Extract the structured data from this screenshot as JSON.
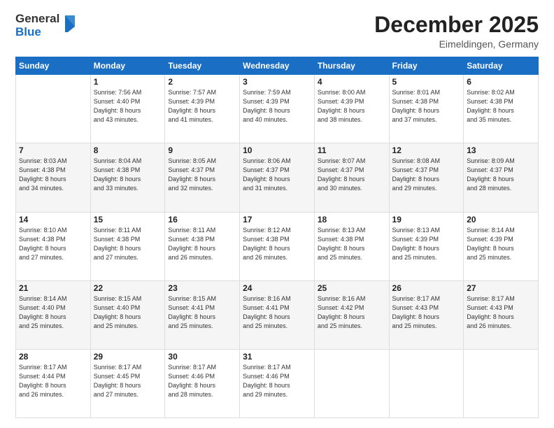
{
  "header": {
    "logo_line1": "General",
    "logo_line2": "Blue",
    "month": "December 2025",
    "location": "Eimeldingen, Germany"
  },
  "weekdays": [
    "Sunday",
    "Monday",
    "Tuesday",
    "Wednesday",
    "Thursday",
    "Friday",
    "Saturday"
  ],
  "rows": [
    [
      {
        "day": "",
        "info": ""
      },
      {
        "day": "1",
        "info": "Sunrise: 7:56 AM\nSunset: 4:40 PM\nDaylight: 8 hours\nand 43 minutes."
      },
      {
        "day": "2",
        "info": "Sunrise: 7:57 AM\nSunset: 4:39 PM\nDaylight: 8 hours\nand 41 minutes."
      },
      {
        "day": "3",
        "info": "Sunrise: 7:59 AM\nSunset: 4:39 PM\nDaylight: 8 hours\nand 40 minutes."
      },
      {
        "day": "4",
        "info": "Sunrise: 8:00 AM\nSunset: 4:39 PM\nDaylight: 8 hours\nand 38 minutes."
      },
      {
        "day": "5",
        "info": "Sunrise: 8:01 AM\nSunset: 4:38 PM\nDaylight: 8 hours\nand 37 minutes."
      },
      {
        "day": "6",
        "info": "Sunrise: 8:02 AM\nSunset: 4:38 PM\nDaylight: 8 hours\nand 35 minutes."
      }
    ],
    [
      {
        "day": "7",
        "info": "Sunrise: 8:03 AM\nSunset: 4:38 PM\nDaylight: 8 hours\nand 34 minutes."
      },
      {
        "day": "8",
        "info": "Sunrise: 8:04 AM\nSunset: 4:38 PM\nDaylight: 8 hours\nand 33 minutes."
      },
      {
        "day": "9",
        "info": "Sunrise: 8:05 AM\nSunset: 4:37 PM\nDaylight: 8 hours\nand 32 minutes."
      },
      {
        "day": "10",
        "info": "Sunrise: 8:06 AM\nSunset: 4:37 PM\nDaylight: 8 hours\nand 31 minutes."
      },
      {
        "day": "11",
        "info": "Sunrise: 8:07 AM\nSunset: 4:37 PM\nDaylight: 8 hours\nand 30 minutes."
      },
      {
        "day": "12",
        "info": "Sunrise: 8:08 AM\nSunset: 4:37 PM\nDaylight: 8 hours\nand 29 minutes."
      },
      {
        "day": "13",
        "info": "Sunrise: 8:09 AM\nSunset: 4:37 PM\nDaylight: 8 hours\nand 28 minutes."
      }
    ],
    [
      {
        "day": "14",
        "info": "Sunrise: 8:10 AM\nSunset: 4:38 PM\nDaylight: 8 hours\nand 27 minutes."
      },
      {
        "day": "15",
        "info": "Sunrise: 8:11 AM\nSunset: 4:38 PM\nDaylight: 8 hours\nand 27 minutes."
      },
      {
        "day": "16",
        "info": "Sunrise: 8:11 AM\nSunset: 4:38 PM\nDaylight: 8 hours\nand 26 minutes."
      },
      {
        "day": "17",
        "info": "Sunrise: 8:12 AM\nSunset: 4:38 PM\nDaylight: 8 hours\nand 26 minutes."
      },
      {
        "day": "18",
        "info": "Sunrise: 8:13 AM\nSunset: 4:38 PM\nDaylight: 8 hours\nand 25 minutes."
      },
      {
        "day": "19",
        "info": "Sunrise: 8:13 AM\nSunset: 4:39 PM\nDaylight: 8 hours\nand 25 minutes."
      },
      {
        "day": "20",
        "info": "Sunrise: 8:14 AM\nSunset: 4:39 PM\nDaylight: 8 hours\nand 25 minutes."
      }
    ],
    [
      {
        "day": "21",
        "info": "Sunrise: 8:14 AM\nSunset: 4:40 PM\nDaylight: 8 hours\nand 25 minutes."
      },
      {
        "day": "22",
        "info": "Sunrise: 8:15 AM\nSunset: 4:40 PM\nDaylight: 8 hours\nand 25 minutes."
      },
      {
        "day": "23",
        "info": "Sunrise: 8:15 AM\nSunset: 4:41 PM\nDaylight: 8 hours\nand 25 minutes."
      },
      {
        "day": "24",
        "info": "Sunrise: 8:16 AM\nSunset: 4:41 PM\nDaylight: 8 hours\nand 25 minutes."
      },
      {
        "day": "25",
        "info": "Sunrise: 8:16 AM\nSunset: 4:42 PM\nDaylight: 8 hours\nand 25 minutes."
      },
      {
        "day": "26",
        "info": "Sunrise: 8:17 AM\nSunset: 4:43 PM\nDaylight: 8 hours\nand 25 minutes."
      },
      {
        "day": "27",
        "info": "Sunrise: 8:17 AM\nSunset: 4:43 PM\nDaylight: 8 hours\nand 26 minutes."
      }
    ],
    [
      {
        "day": "28",
        "info": "Sunrise: 8:17 AM\nSunset: 4:44 PM\nDaylight: 8 hours\nand 26 minutes."
      },
      {
        "day": "29",
        "info": "Sunrise: 8:17 AM\nSunset: 4:45 PM\nDaylight: 8 hours\nand 27 minutes."
      },
      {
        "day": "30",
        "info": "Sunrise: 8:17 AM\nSunset: 4:46 PM\nDaylight: 8 hours\nand 28 minutes."
      },
      {
        "day": "31",
        "info": "Sunrise: 8:17 AM\nSunset: 4:46 PM\nDaylight: 8 hours\nand 29 minutes."
      },
      {
        "day": "",
        "info": ""
      },
      {
        "day": "",
        "info": ""
      },
      {
        "day": "",
        "info": ""
      }
    ]
  ]
}
